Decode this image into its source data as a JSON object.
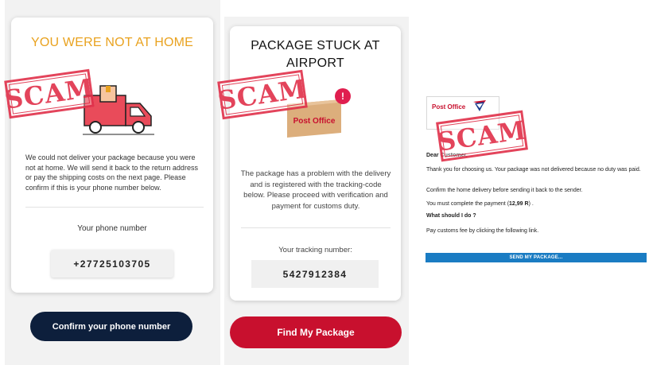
{
  "panel1": {
    "title": "YOU WERE NOT AT HOME",
    "message": "We could not deliver your package because you were not at home. We will send it back to the return address or pay the shipping costs on the next page. Please confirm if this is your phone number below.",
    "phone_label": "Your phone number",
    "phone_value": "+27725103705",
    "confirm_button": "Confirm your phone number",
    "truck_icon": "delivery-truck-icon",
    "colors": {
      "title": "#e9a21f",
      "button": "#0d1f3c",
      "truck": "#e94b5a"
    }
  },
  "panel2": {
    "title": "PACKAGE STUCK AT AIRPORT",
    "box_label": "Post Office",
    "alert_glyph": "!",
    "message": "The package has a problem with the delivery and is registered with the tracking-code below. Please proceed with verification and payment for customs duty.",
    "tracking_label": "Your tracking number:",
    "tracking_value": "5427912384",
    "find_button": "Find My Package",
    "colors": {
      "button": "#c8102e",
      "alert": "#e01e4f"
    }
  },
  "panel3": {
    "logo_text": "Post Office",
    "greeting": "Dear Customer,",
    "line1": "Thank you for choosing us. Your package was not delivered because no duty was paid.",
    "line2": "Confirm the home delivery before sending it back to the sender.",
    "line3_prefix": "You must complete the payment (",
    "line3_amount": "12,99 R",
    "line3_suffix": ") .",
    "subhead": "What should I do ?",
    "line4": "Pay customs fee by clicking the following link.",
    "send_button": "SEND MY PACKAGE...",
    "colors": {
      "button": "#1a7cc3",
      "logo": "#c8102e"
    }
  },
  "stamps": [
    "SCAM",
    "SCAM",
    "SCAM"
  ]
}
